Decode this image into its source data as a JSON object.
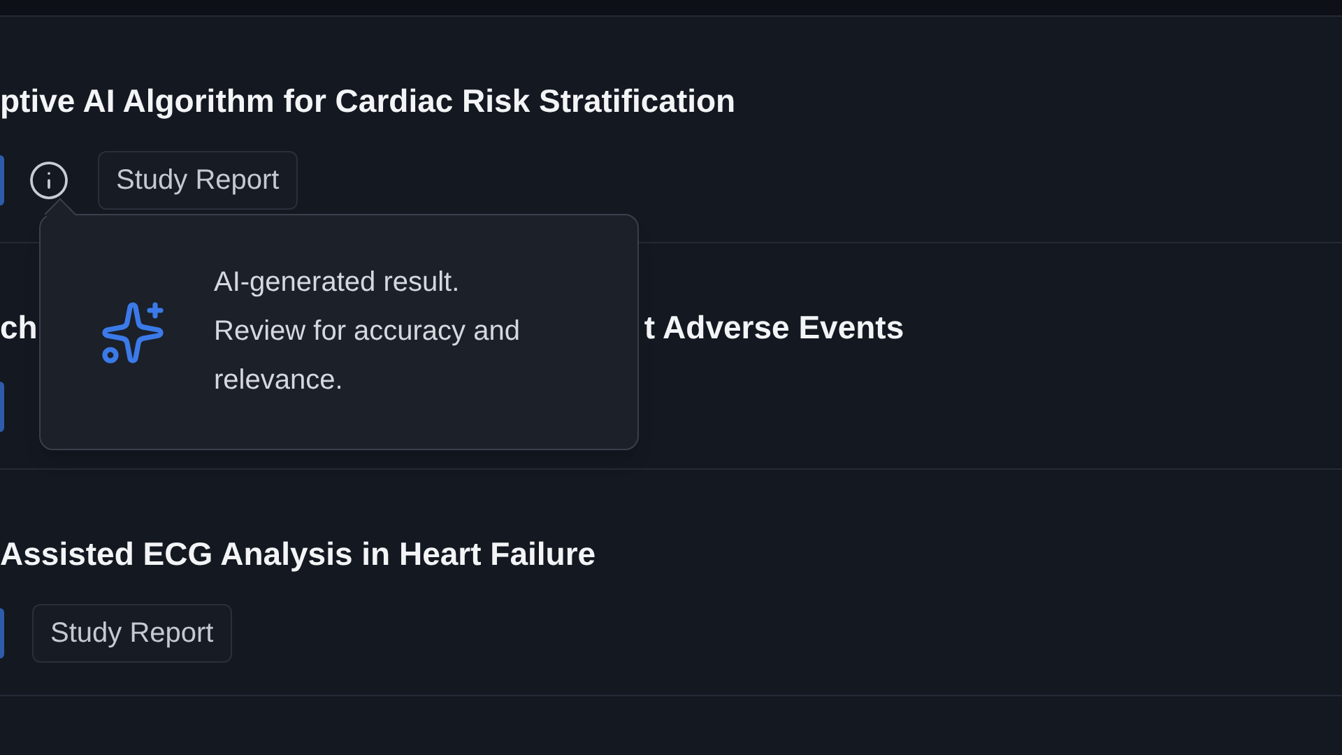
{
  "rows": [
    {
      "title_parts": [
        "ptive AI Algorithm for Cardiac Risk Stratification"
      ],
      "info": true,
      "tag": "Study Report"
    },
    {
      "title_parts": [
        "ch",
        "t Adverse Events"
      ],
      "info": false
    },
    {
      "title_parts": [
        "Assisted ECG Analysis in Heart Failure"
      ],
      "info": false,
      "tag": "Study Report"
    }
  ],
  "tooltip": {
    "text": "AI-generated result. Review for accuracy and relevance."
  }
}
